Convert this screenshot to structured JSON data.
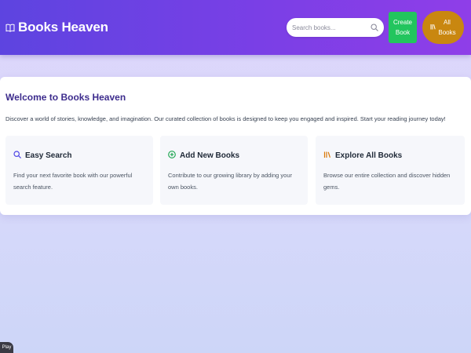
{
  "header": {
    "brand_icon": "book-open-icon",
    "brand_title": "Books Heaven",
    "search": {
      "placeholder": "Search books...",
      "value": "",
      "icon": "search-icon"
    },
    "create_button": {
      "line1": "Create",
      "line2": "Book",
      "color": "#22c55e"
    },
    "all_books_button": {
      "icon": "library-icon",
      "line1": "All",
      "line2": "Books",
      "color": "#c98710"
    }
  },
  "welcome": {
    "title": "Welcome to Books Heaven",
    "text": "Discover a world of stories, knowledge, and imagination. Our curated collection of books is designed to keep you engaged and inspired. Start your reading journey today!"
  },
  "features": [
    {
      "icon": "search-icon",
      "title": "Easy Search",
      "text": "Find your next favorite book with our powerful search feature."
    },
    {
      "icon": "plus-circle-icon",
      "title": "Add New Books",
      "text": "Contribute to our growing library by adding your own books."
    },
    {
      "icon": "library-icon",
      "title": "Explore All Books",
      "text": "Browse our entire collection and discover hidden gems."
    }
  ],
  "player": {
    "label": "Play"
  },
  "colors": {
    "header_start": "#5d44e0",
    "header_end": "#8f3ee8",
    "title": "#3d2c8d",
    "accent_green": "#22c55e",
    "accent_gold": "#c98710"
  }
}
